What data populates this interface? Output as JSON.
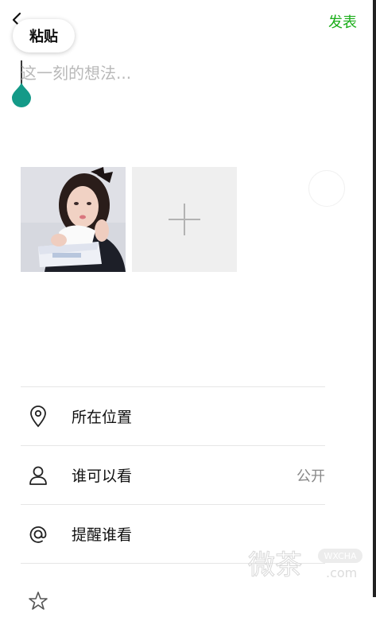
{
  "header": {
    "post_label": "发表",
    "paste_label": "粘贴"
  },
  "composer": {
    "placeholder": "这一刻的想法..."
  },
  "menu": {
    "location_label": "所在位置",
    "visibility_label": "谁可以看",
    "visibility_value": "公开",
    "mention_label": "提醒谁看"
  },
  "icons": {
    "back": "chevron-left-icon",
    "location": "map-pin-icon",
    "visibility": "person-icon",
    "mention": "at-sign-icon",
    "add": "plus-icon",
    "bottom_partial": "star-icon"
  },
  "watermark": {
    "logo_text": "微茶",
    "sub_text": "WXCHA",
    "domain_text": ".com"
  },
  "colors": {
    "accent_green": "#1aad19",
    "handle_teal": "#149a88",
    "divider": "#e6e6e6"
  }
}
